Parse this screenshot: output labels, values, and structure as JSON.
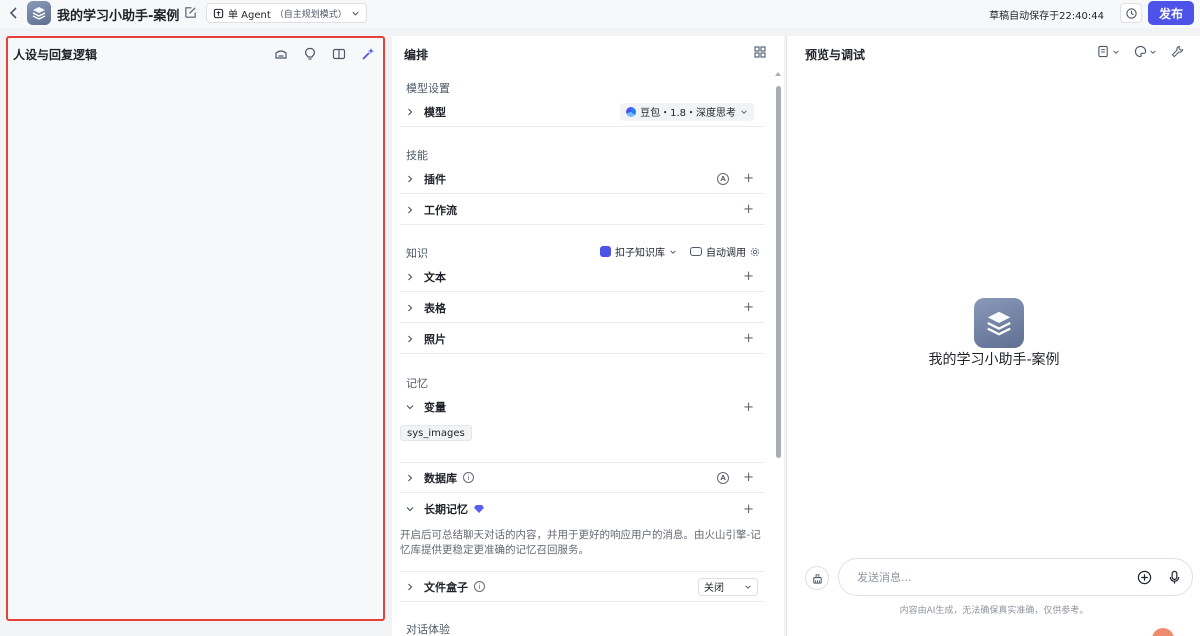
{
  "topbar": {
    "app_title": "我的学习小助手-案例",
    "mode_label": "单 Agent",
    "mode_sub": "（自主规划模式）",
    "save_status": "草稿自动保存于22:40:44",
    "publish_label": "发布"
  },
  "persona": {
    "title": "人设与回复逻辑"
  },
  "arrange": {
    "title": "编排",
    "model_section": "模型设置",
    "model_row": "模型",
    "model_value": "豆包・1.8・深度思考",
    "skills_section": "技能",
    "plugins_row": "插件",
    "workflow_row": "工作流",
    "knowledge_section": "知识",
    "kb_select": "扣子知识库",
    "auto_call": "自动调用",
    "text_row": "文本",
    "table_row": "表格",
    "photo_row": "照片",
    "memory_section": "记忆",
    "variable_row": "变量",
    "variable_tag": "sys_images",
    "database_row": "数据库",
    "longterm_row": "长期记忆",
    "longterm_desc": "开启后可总结聊天对话的内容，并用于更好的响应用户的消息。由火山引擎-记忆库提供更稳定更准确的记忆召回服务。",
    "filebox_row": "文件盒子",
    "filebox_value": "关闭",
    "dialog_section": "对话体验",
    "plus": "+",
    "auto_badge": "A",
    "info_badge": "i"
  },
  "preview": {
    "title": "预览与调试",
    "bot_name": "我的学习小助手-案例",
    "input_placeholder": "发送消息...",
    "disclaimer": "内容由AI生成，无法确保真实准确，仅供参考。"
  },
  "colors": {
    "accent": "#4d53e8",
    "highlight_border": "#e4413b"
  }
}
